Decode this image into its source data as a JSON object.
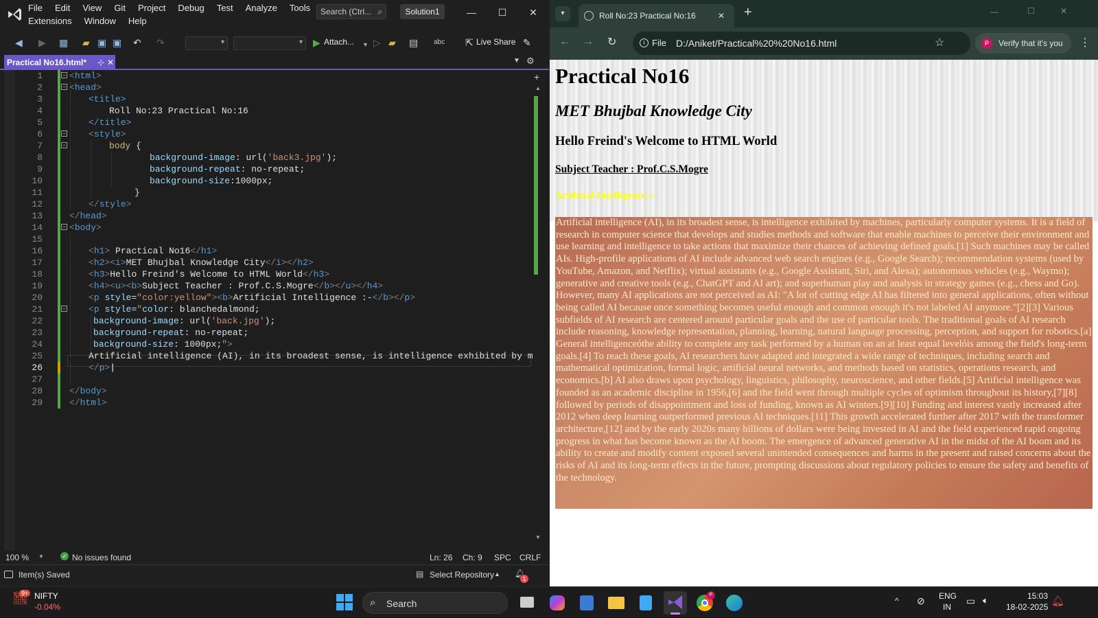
{
  "vs": {
    "menu": [
      "File",
      "Edit",
      "View",
      "Git",
      "Project",
      "Debug",
      "Test",
      "Analyze",
      "Tools"
    ],
    "menu2": [
      "Extensions",
      "Window",
      "Help"
    ],
    "search_placeholder": "Search (Ctrl...",
    "solution": "Solution1",
    "toolbar": {
      "attach": "Attach...",
      "live_share": "Live Share"
    },
    "tab": {
      "label": "Practical No16.html*",
      "pin": "⊹",
      "close": "✕"
    },
    "code_lines": [
      {
        "n": "1"
      },
      {
        "n": "2"
      },
      {
        "n": "3"
      },
      {
        "n": "4"
      },
      {
        "n": "5"
      },
      {
        "n": "6"
      },
      {
        "n": "7"
      },
      {
        "n": "8"
      },
      {
        "n": "9"
      },
      {
        "n": "10"
      },
      {
        "n": "11"
      },
      {
        "n": "12"
      },
      {
        "n": "13"
      },
      {
        "n": "14"
      },
      {
        "n": "15"
      },
      {
        "n": "16"
      },
      {
        "n": "17"
      },
      {
        "n": "18"
      },
      {
        "n": "19"
      },
      {
        "n": "20"
      },
      {
        "n": "21"
      },
      {
        "n": "22"
      },
      {
        "n": "23"
      },
      {
        "n": "24"
      },
      {
        "n": "25"
      },
      {
        "n": "26"
      },
      {
        "n": "27"
      },
      {
        "n": "28"
      },
      {
        "n": "29"
      }
    ],
    "code_text": {
      "l3": "<title>",
      "l4": "Roll No:23 Practical No:16",
      "l5": "</title>",
      "l25": "Artificial intelligence (AI), in its broadest sense, is intelligence exhibited by mac"
    },
    "status": {
      "zoom": "100 %",
      "issues": "No issues found",
      "ln": "Ln: 26",
      "ch": "Ch: 9",
      "spc": "SPC",
      "crlf": "CRLF",
      "saved": "Item(s) Saved",
      "repo": "Select Repository",
      "notif": "1"
    }
  },
  "chrome": {
    "tab_title": "Roll No:23 Practical No:16",
    "address_chip": "File",
    "url": "D:/Aniket/Practical%20%20No16.html",
    "verify": "Verify that it's you",
    "profile_initial": "P",
    "page": {
      "h1": "Practical No16",
      "h2": "MET Bhujbal Knowledge City",
      "h3": "Hello Freind's Welcome to HTML World",
      "h4": "Subject Teacher : Prof.C.S.Mogre",
      "ai_heading": "Artificial Intelligence :-",
      "ai_text": "Artificial intelligence (AI), in its broadest sense, is intelligence exhibited by machines, particularly computer systems. It is a field of research in computer science that develops and studies methods and software that enable machines to perceive their environment and use learning and intelligence to take actions that maximize their chances of achieving defined goals.[1] Such machines may be called AIs. High-profile applications of AI include advanced web search engines (e.g., Google Search); recommendation systems (used by YouTube, Amazon, and Netflix); virtual assistants (e.g., Google Assistant, Siri, and Alexa); autonomous vehicles (e.g., Waymo); generative and creative tools (e.g., ChatGPT and AI art); and superhuman play and analysis in strategy games (e.g., chess and Go). However, many AI applications are not perceived as AI: \"A lot of cutting edge AI has filtered into general applications, often without being called AI because once something becomes useful enough and common enough it's not labeled AI anymore.\"[2][3] Various subfields of AI research are centered around particular goals and the use of particular tools. The traditional goals of AI research include reasoning, knowledge representation, planning, learning, natural language processing, perception, and support for robotics.[a] General intelligenceóthe ability to complete any task performed by a human on an at least equal levelóis among the field's long-term goals.[4] To reach these goals, AI researchers have adapted and integrated a wide range of techniques, including search and mathematical optimization, formal logic, artificial neural networks, and methods based on statistics, operations research, and economics.[b] AI also draws upon psychology, linguistics, philosophy, neuroscience, and other fields.[5] Artificial intelligence was founded as an academic discipline in 1956,[6] and the field went through multiple cycles of optimism throughout its history,[7][8] followed by periods of disappointment and loss of funding, known as AI winters.[9][10] Funding and interest vastly increased after 2012 when deep learning outperformed previous AI techniques.[11] This growth accelerated further after 2017 with the transformer architecture,[12] and by the early 2020s many billions of dollars were being invested in AI and the field experienced rapid ongoing progress in what has become known as the AI boom. The emergence of advanced generative AI in the midst of the AI boom and its ability to create and modify content exposed several unintended consequences and harms in the present and raised concerns about the risks of AI and its long-term effects in the future, prompting discussions about regulatory policies to ensure the safety and benefits of the technology."
    }
  },
  "taskbar": {
    "stock_name": "NIFTY",
    "stock_change": "-0.04%",
    "stock_badge": "9+",
    "search": "Search",
    "lang1": "ENG",
    "lang2": "IN",
    "time": "15:03",
    "date": "18-02-2025"
  },
  "colors": {
    "accent": "#6b57c7",
    "ai_heading": "#ffff00",
    "ai_text": "#ffebcd",
    "edge_green": "#57a64a"
  }
}
